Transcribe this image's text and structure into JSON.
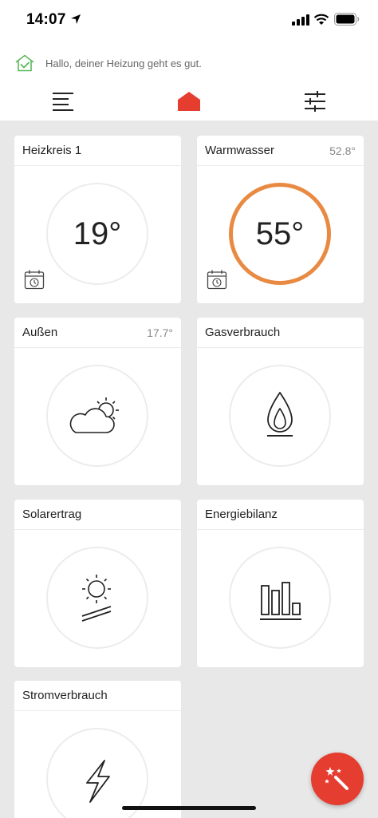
{
  "status_bar": {
    "time": "14:07"
  },
  "notice": {
    "text": "Hallo, deiner Heizung geht es gut.",
    "accent_color": "#5cb85c"
  },
  "nav": {
    "active_color": "#e53d2f",
    "items": [
      "menu-icon",
      "home-icon",
      "sliders-icon"
    ]
  },
  "cards": {
    "heizkreis": {
      "title": "Heizkreis 1",
      "temperature": "19°"
    },
    "warmwasser": {
      "title": "Warmwasser",
      "value": "52.8°",
      "temperature": "55°",
      "ring_color": "#e98a43"
    },
    "aussen": {
      "title": "Außen",
      "value": "17.7°",
      "icon": "partly-cloudy-icon"
    },
    "gas": {
      "title": "Gasverbrauch",
      "icon": "flame-icon"
    },
    "solar": {
      "title": "Solarertrag",
      "icon": "sun-panel-icon"
    },
    "energie": {
      "title": "Energiebilanz",
      "icon": "bar-chart-icon"
    },
    "strom": {
      "title": "Stromverbrauch",
      "icon": "lightning-icon"
    }
  },
  "fab": {
    "icon": "magic-wand-icon",
    "color": "#e53d2f"
  }
}
